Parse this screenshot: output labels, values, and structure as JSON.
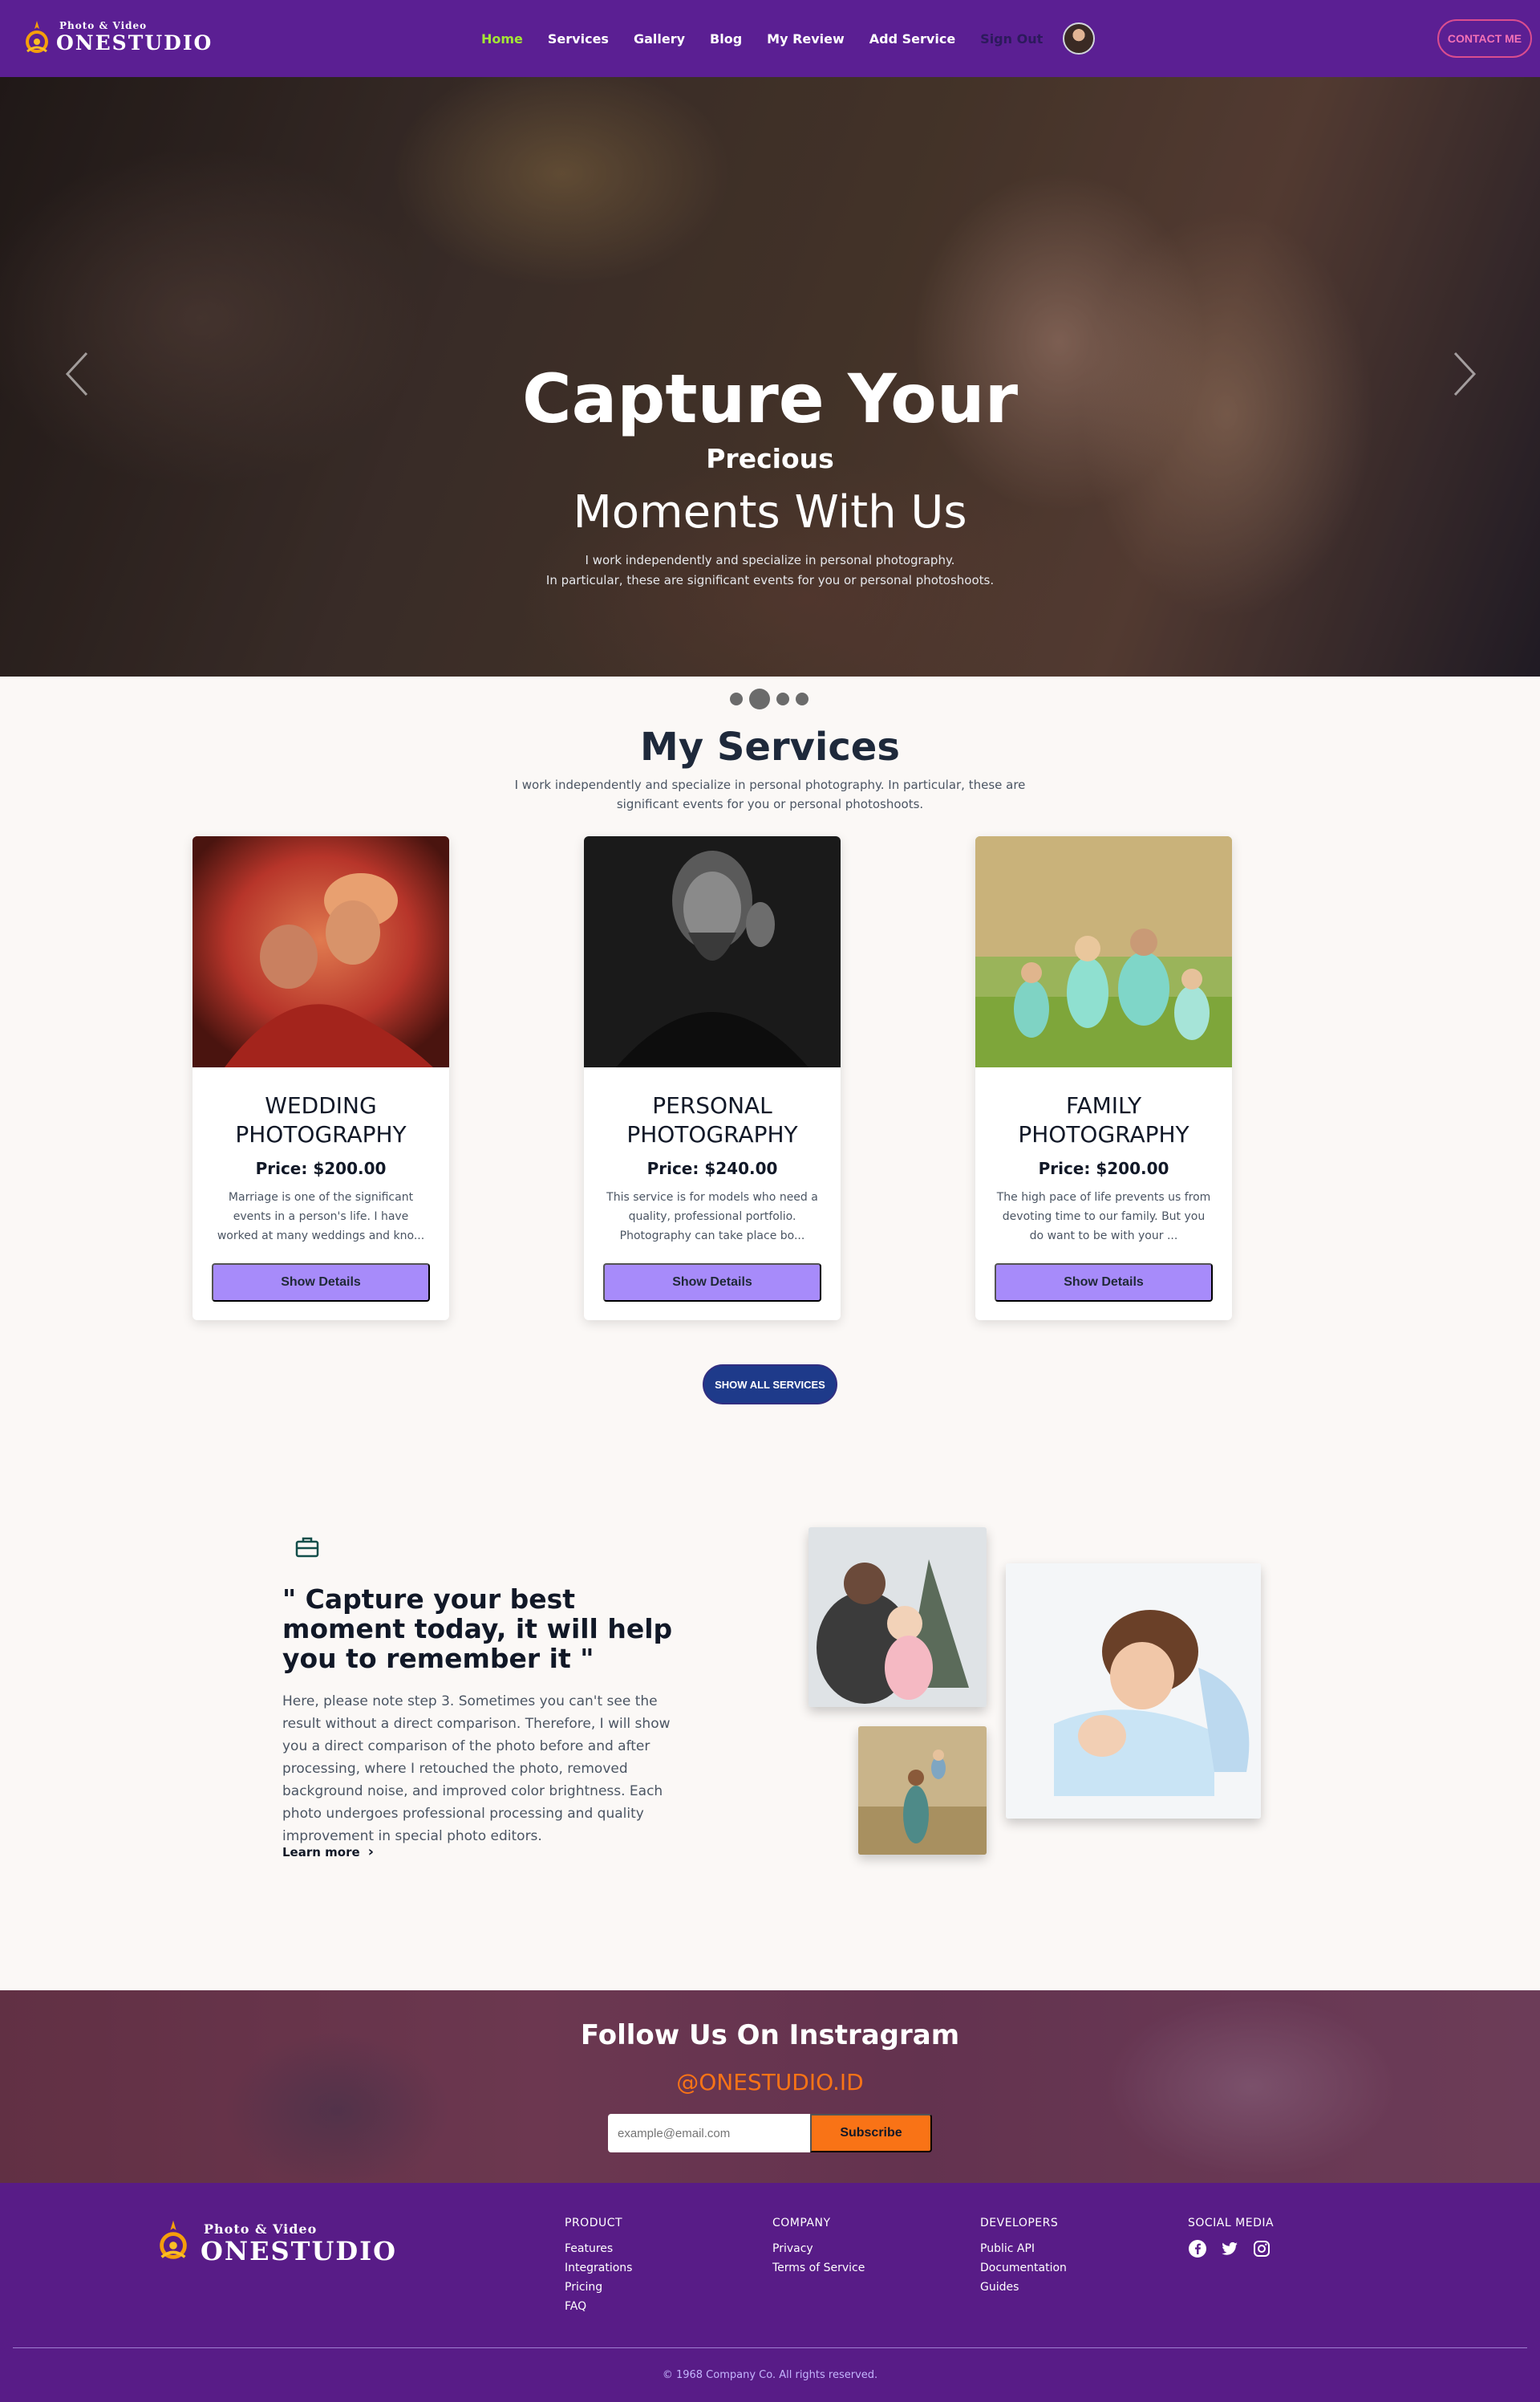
{
  "brand": {
    "tagline": "Photo & Video",
    "name": "ONESTUDIO"
  },
  "nav": {
    "links": [
      {
        "label": "Home",
        "active": true
      },
      {
        "label": "Services"
      },
      {
        "label": "Gallery"
      },
      {
        "label": "Blog"
      },
      {
        "label": "My Review"
      },
      {
        "label": "Add Service"
      },
      {
        "label": "Sign Out"
      }
    ],
    "contact_label": "CONTACT ME"
  },
  "hero": {
    "title": "Capture Your",
    "subtitle": "Precious",
    "title2": "Moments With Us",
    "desc_line1": "I work independently and specialize in personal photography.",
    "desc_line2": "In particular, these are significant events for you or personal photoshoots.",
    "slide_count": 4,
    "active_slide": 1
  },
  "services": {
    "title": "My Services",
    "desc": "I work independently and specialize in personal photography. In particular, these are significant events for you or personal photoshoots.",
    "cards": [
      {
        "title": "WEDDING PHOTOGRAPHY",
        "price": "Price: $200.00",
        "desc": "Marriage is one of the significant events in a person's life. I have worked at many weddings and kno...",
        "button": "Show Details"
      },
      {
        "title": "PERSONAL PHOTOGRAPHY",
        "price": "Price: $240.00",
        "desc": "This service is for models who need a quality, professional portfolio. Photography can take place bo...",
        "button": "Show Details"
      },
      {
        "title": "FAMILY PHOTOGRAPHY",
        "price": "Price: $200.00",
        "desc": "The high pace of life prevents us from devoting time to our family. But you do want to be with your ...",
        "button": "Show Details"
      }
    ],
    "show_all": "SHOW ALL SERVICES"
  },
  "about": {
    "quote": "\" Capture your best moment today, it will help you to remember it \"",
    "text": "Here, please note step 3. Sometimes you can't see the result without a direct comparison. Therefore, I will show you a direct comparison of the photo before and after processing, where I retouched the photo, removed background noise, and improved color brightness. Each photo undergoes professional processing and quality improvement in special photo editors.",
    "learn_more": "Learn more"
  },
  "instagram": {
    "title": "Follow Us On Instragram",
    "handle": "@ONESTUDIO.ID",
    "email_placeholder": "example@email.com",
    "subscribe": "Subscribe"
  },
  "footer": {
    "product": {
      "head": "PRODUCT",
      "items": [
        "Features",
        "Integrations",
        "Pricing",
        "FAQ"
      ]
    },
    "company": {
      "head": "COMPANY",
      "items": [
        "Privacy",
        "Terms of Service"
      ]
    },
    "developers": {
      "head": "DEVELOPERS",
      "items": [
        "Public API",
        "Documentation",
        "Guides"
      ]
    },
    "social": {
      "head": "SOCIAL MEDIA",
      "icons": [
        "facebook-icon",
        "twitter-icon",
        "instagram-icon"
      ]
    },
    "copyright": "© 1968 Company Co. All rights reserved."
  },
  "colors": {
    "nav_bg": "#5b1f93",
    "footer_bg": "#581c87",
    "active_link": "#a3e635",
    "card_button": "#a78bfa",
    "accent_orange": "#f97316",
    "contact_pink": "#f472b6"
  }
}
